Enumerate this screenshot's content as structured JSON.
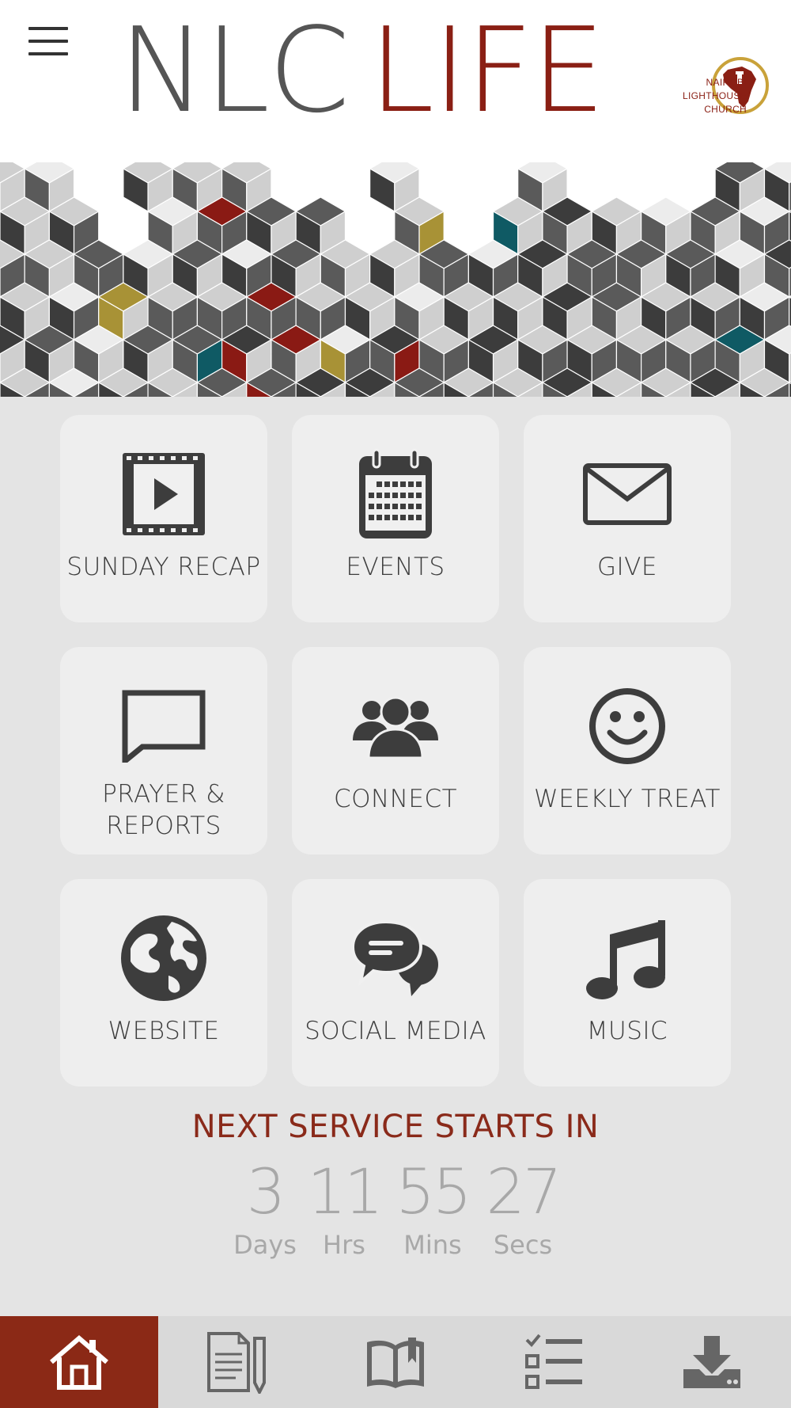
{
  "header": {
    "brand_part1": "NLC",
    "brand_part2": "LIFE",
    "church_name_lines": [
      "NAIROBI",
      "LIGHTHOUSE",
      "CHURCH"
    ],
    "menu_icon": "hamburger-menu-icon"
  },
  "colors": {
    "brand_red": "#8a1f14",
    "nav_active": "#8b2916",
    "countdown_title": "#8a2a1a",
    "countdown_numbers": "#a8a8a8",
    "tile_text": "#3d3d3d"
  },
  "tiles": [
    {
      "label": "SUNDAY RECAP",
      "icon": "film-play-icon"
    },
    {
      "label": "EVENTS",
      "icon": "calendar-icon"
    },
    {
      "label": "GIVE",
      "icon": "envelope-icon"
    },
    {
      "label_line1": "PRAYER &",
      "label_line2": "REPORTS",
      "icon": "speech-bubble-icon"
    },
    {
      "label": "CONNECT",
      "icon": "people-group-icon"
    },
    {
      "label": "WEEKLY TREAT",
      "icon": "smiley-face-icon"
    },
    {
      "label": "WEBSITE",
      "icon": "globe-icon"
    },
    {
      "label": "SOCIAL MEDIA",
      "icon": "chat-bubbles-icon"
    },
    {
      "label": "MUSIC",
      "icon": "music-note-icon"
    }
  ],
  "countdown": {
    "title": "NEXT SERVICE STARTS IN",
    "days": "3",
    "days_label": "Days",
    "hours": "11",
    "hours_label": "Hrs",
    "mins": "55",
    "mins_label": "Mins",
    "secs": "27",
    "secs_label": "Secs"
  },
  "bottom_nav": [
    {
      "icon": "home-icon",
      "active": true
    },
    {
      "icon": "notes-pencil-icon",
      "active": false
    },
    {
      "icon": "open-book-bookmark-icon",
      "active": false
    },
    {
      "icon": "checklist-icon",
      "active": false
    },
    {
      "icon": "download-icon",
      "active": false
    }
  ]
}
